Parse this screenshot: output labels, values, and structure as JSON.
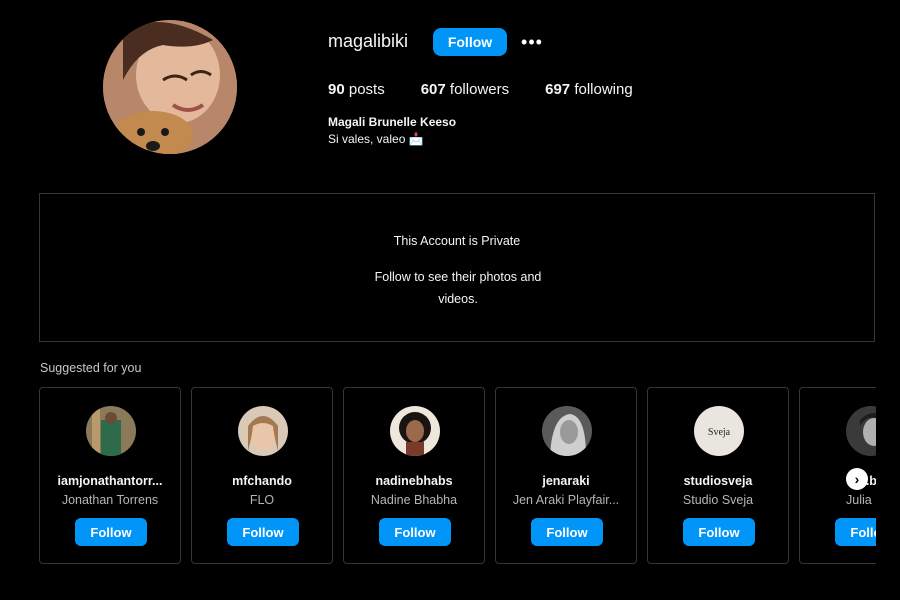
{
  "profile": {
    "username": "magalibiki",
    "follow_label": "Follow",
    "more_icon": "more-horizontal-icon",
    "posts_count": "90",
    "posts_label": "posts",
    "followers_count": "607",
    "followers_label": "followers",
    "following_count": "697",
    "following_label": "following",
    "full_name": "Magali Brunelle Keeso",
    "bio": "Si vales, valeo 📩"
  },
  "private": {
    "title": "This Account is Private",
    "subtitle": "Follow to see their photos and videos."
  },
  "suggested": {
    "heading": "Suggested for you",
    "follow_label": "Follow",
    "items": [
      {
        "handle": "iamjonathantorr...",
        "name": "Jonathan Torrens"
      },
      {
        "handle": "mfchando",
        "name": "FLO"
      },
      {
        "handle": "nadinebhabs",
        "name": "Nadine Bhabha"
      },
      {
        "handle": "jenaraki",
        "name": "Jen Araki Playfair..."
      },
      {
        "handle": "studiosveja",
        "name": "Studio Sveja",
        "logo_text": "Sveja"
      },
      {
        "handle": "j...bo",
        "name": "Julia B..."
      }
    ],
    "next_icon": "chevron-right-icon"
  },
  "colors": {
    "accent": "#0095f6",
    "background": "#000000",
    "border": "#363636"
  }
}
